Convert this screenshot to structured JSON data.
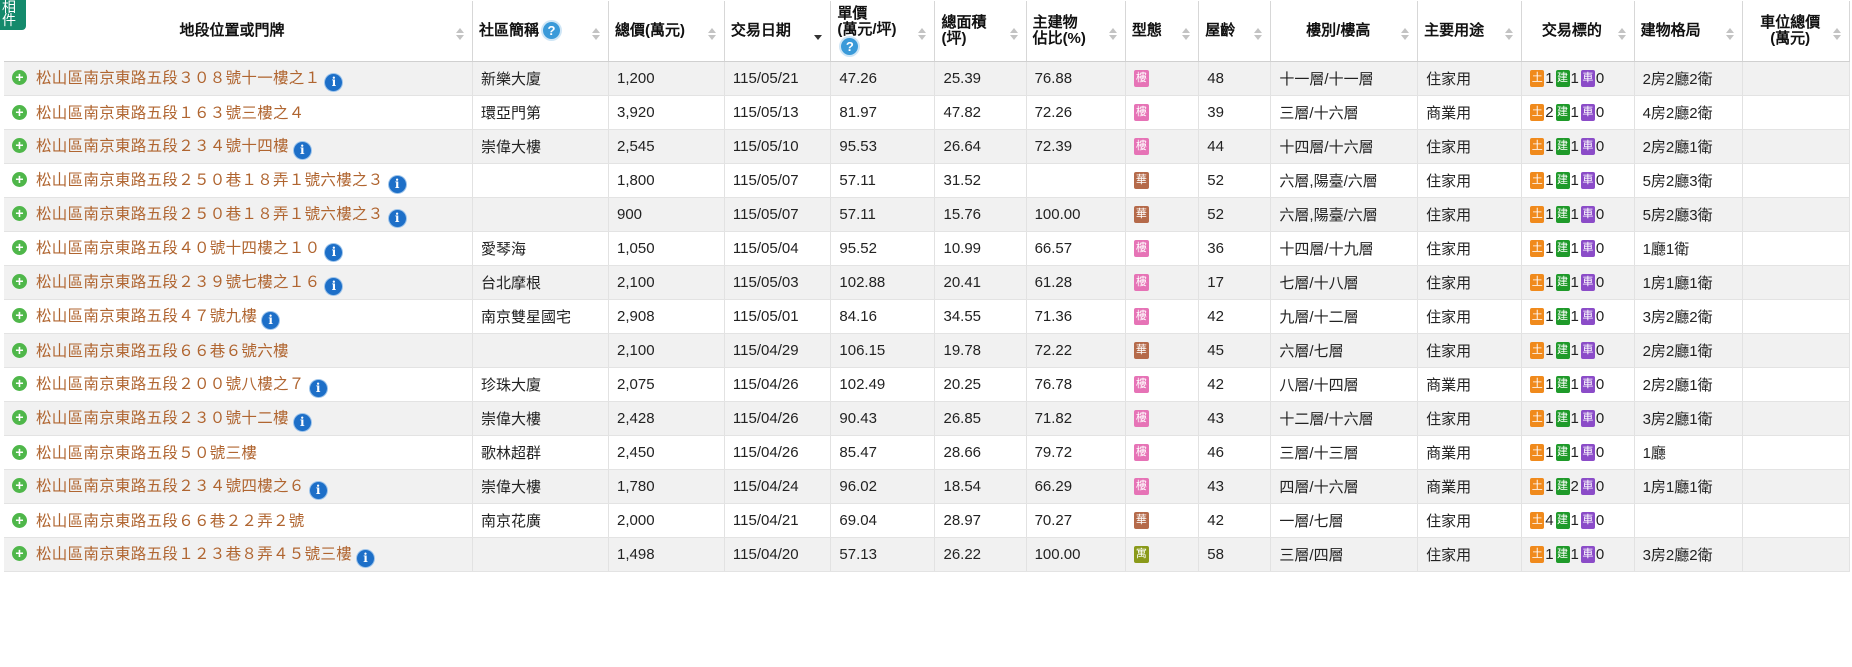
{
  "corner_tag": "相\n件",
  "headers": [
    {
      "label": "地段位置或門牌",
      "align": "c"
    },
    {
      "label": "社區簡稱",
      "align": "l",
      "help": "?"
    },
    {
      "label": "總價(萬元)",
      "align": "l"
    },
    {
      "label": "交易日期",
      "align": "l",
      "active": true
    },
    {
      "label": "單價\n(萬元/坪)",
      "align": "l",
      "help": "?"
    },
    {
      "label": "總面積\n(坪)",
      "align": "l"
    },
    {
      "label": "主建物\n佔比(%)",
      "align": "l"
    },
    {
      "label": "型態",
      "align": "l"
    },
    {
      "label": "屋齡",
      "align": "l"
    },
    {
      "label": "樓別/樓高",
      "align": "c"
    },
    {
      "label": "主要用途",
      "align": "l"
    },
    {
      "label": "交易標的",
      "align": "c"
    },
    {
      "label": "建物格局",
      "align": "l"
    },
    {
      "label": "車位總價\n(萬元)",
      "align": "c"
    }
  ],
  "badge_labels": {
    "land": "土",
    "bldg": "建",
    "car": "車"
  },
  "type_colors": {
    "樓": "#e673b6",
    "華": "#b56a4a",
    "寓": "#8a9a1a"
  },
  "rows": [
    {
      "addr": "松山區南京東路五段３０８號十一樓之１",
      "info": true,
      "community": "新樂大廈",
      "price": "1,200",
      "date": "115/05/21",
      "unit": "47.26",
      "area": "25.39",
      "ratio": "76.88",
      "type": "樓",
      "age": "48",
      "floor": "十一層/十一層",
      "use": "住家用",
      "land": "1",
      "bldg": "1",
      "car": "0",
      "layout": "2房2廳2衛",
      "parking": ""
    },
    {
      "addr": "松山區南京東路五段１６３號三樓之４",
      "info": false,
      "community": "環亞門第",
      "price": "3,920",
      "date": "115/05/13",
      "unit": "81.97",
      "area": "47.82",
      "ratio": "72.26",
      "type": "樓",
      "age": "39",
      "floor": "三層/十六層",
      "use": "商業用",
      "land": "2",
      "bldg": "1",
      "car": "0",
      "layout": "4房2廳2衛",
      "parking": ""
    },
    {
      "addr": "松山區南京東路五段２３４號十四樓",
      "info": true,
      "community": "崇偉大樓",
      "price": "2,545",
      "date": "115/05/10",
      "unit": "95.53",
      "area": "26.64",
      "ratio": "72.39",
      "type": "樓",
      "age": "44",
      "floor": "十四層/十六層",
      "use": "住家用",
      "land": "1",
      "bldg": "1",
      "car": "0",
      "layout": "2房2廳1衛",
      "parking": ""
    },
    {
      "addr": "松山區南京東路五段２５０巷１８弄１號六樓之３",
      "info": true,
      "community": "",
      "price": "1,800",
      "date": "115/05/07",
      "unit": "57.11",
      "area": "31.52",
      "ratio": "",
      "type": "華",
      "age": "52",
      "floor": "六層,陽臺/六層",
      "use": "住家用",
      "land": "1",
      "bldg": "1",
      "car": "0",
      "layout": "5房2廳3衛",
      "parking": ""
    },
    {
      "addr": "松山區南京東路五段２５０巷１８弄１號六樓之３",
      "info": true,
      "community": "",
      "price": "900",
      "date": "115/05/07",
      "unit": "57.11",
      "area": "15.76",
      "ratio": "100.00",
      "type": "華",
      "age": "52",
      "floor": "六層,陽臺/六層",
      "use": "住家用",
      "land": "1",
      "bldg": "1",
      "car": "0",
      "layout": "5房2廳3衛",
      "parking": ""
    },
    {
      "addr": "松山區南京東路五段４０號十四樓之１０",
      "info": true,
      "community": "愛琴海",
      "price": "1,050",
      "date": "115/05/04",
      "unit": "95.52",
      "area": "10.99",
      "ratio": "66.57",
      "type": "樓",
      "age": "36",
      "floor": "十四層/十九層",
      "use": "住家用",
      "land": "1",
      "bldg": "1",
      "car": "0",
      "layout": "1廳1衛",
      "parking": ""
    },
    {
      "addr": "松山區南京東路五段２３９號七樓之１６",
      "info": true,
      "community": "台北摩根",
      "price": "2,100",
      "date": "115/05/03",
      "unit": "102.88",
      "area": "20.41",
      "ratio": "61.28",
      "type": "樓",
      "age": "17",
      "floor": "七層/十八層",
      "use": "住家用",
      "land": "1",
      "bldg": "1",
      "car": "0",
      "layout": "1房1廳1衛",
      "parking": ""
    },
    {
      "addr": "松山區南京東路五段４７號九樓",
      "info": true,
      "community": "南京雙星國宅",
      "price": "2,908",
      "date": "115/05/01",
      "unit": "84.16",
      "area": "34.55",
      "ratio": "71.36",
      "type": "樓",
      "age": "42",
      "floor": "九層/十二層",
      "use": "住家用",
      "land": "1",
      "bldg": "1",
      "car": "0",
      "layout": "3房2廳2衛",
      "parking": ""
    },
    {
      "addr": "松山區南京東路五段６６巷６號六樓",
      "info": false,
      "community": "",
      "price": "2,100",
      "date": "115/04/29",
      "unit": "106.15",
      "area": "19.78",
      "ratio": "72.22",
      "type": "華",
      "age": "45",
      "floor": "六層/七層",
      "use": "住家用",
      "land": "1",
      "bldg": "1",
      "car": "0",
      "layout": "2房2廳1衛",
      "parking": ""
    },
    {
      "addr": "松山區南京東路五段２００號八樓之７",
      "info": true,
      "community": "珍珠大廈",
      "price": "2,075",
      "date": "115/04/26",
      "unit": "102.49",
      "area": "20.25",
      "ratio": "76.78",
      "type": "樓",
      "age": "42",
      "floor": "八層/十四層",
      "use": "商業用",
      "land": "1",
      "bldg": "1",
      "car": "0",
      "layout": "2房2廳1衛",
      "parking": ""
    },
    {
      "addr": "松山區南京東路五段２３０號十二樓",
      "info": true,
      "community": "崇偉大樓",
      "price": "2,428",
      "date": "115/04/26",
      "unit": "90.43",
      "area": "26.85",
      "ratio": "71.82",
      "type": "樓",
      "age": "43",
      "floor": "十二層/十六層",
      "use": "住家用",
      "land": "1",
      "bldg": "1",
      "car": "0",
      "layout": "3房2廳1衛",
      "parking": ""
    },
    {
      "addr": "松山區南京東路五段５０號三樓",
      "info": false,
      "community": "歌林超群",
      "price": "2,450",
      "date": "115/04/26",
      "unit": "85.47",
      "area": "28.66",
      "ratio": "79.72",
      "type": "樓",
      "age": "46",
      "floor": "三層/十三層",
      "use": "商業用",
      "land": "1",
      "bldg": "1",
      "car": "0",
      "layout": "1廳",
      "parking": ""
    },
    {
      "addr": "松山區南京東路五段２３４號四樓之６",
      "info": true,
      "community": "崇偉大樓",
      "price": "1,780",
      "date": "115/04/24",
      "unit": "96.02",
      "area": "18.54",
      "ratio": "66.29",
      "type": "樓",
      "age": "43",
      "floor": "四層/十六層",
      "use": "商業用",
      "land": "1",
      "bldg": "2",
      "car": "0",
      "layout": "1房1廳1衛",
      "parking": ""
    },
    {
      "addr": "松山區南京東路五段６６巷２２弄２號",
      "info": false,
      "community": "南京花廣",
      "price": "2,000",
      "date": "115/04/21",
      "unit": "69.04",
      "area": "28.97",
      "ratio": "70.27",
      "type": "華",
      "age": "42",
      "floor": "一層/七層",
      "use": "住家用",
      "land": "4",
      "bldg": "1",
      "car": "0",
      "layout": "",
      "parking": ""
    },
    {
      "addr": "松山區南京東路五段１２３巷８弄４５號三樓",
      "info": true,
      "community": "",
      "price": "1,498",
      "date": "115/04/20",
      "unit": "57.13",
      "area": "26.22",
      "ratio": "100.00",
      "type": "寓",
      "age": "58",
      "floor": "三層/四層",
      "use": "住家用",
      "land": "1",
      "bldg": "1",
      "car": "0",
      "layout": "3房2廳2衛",
      "parking": ""
    }
  ]
}
